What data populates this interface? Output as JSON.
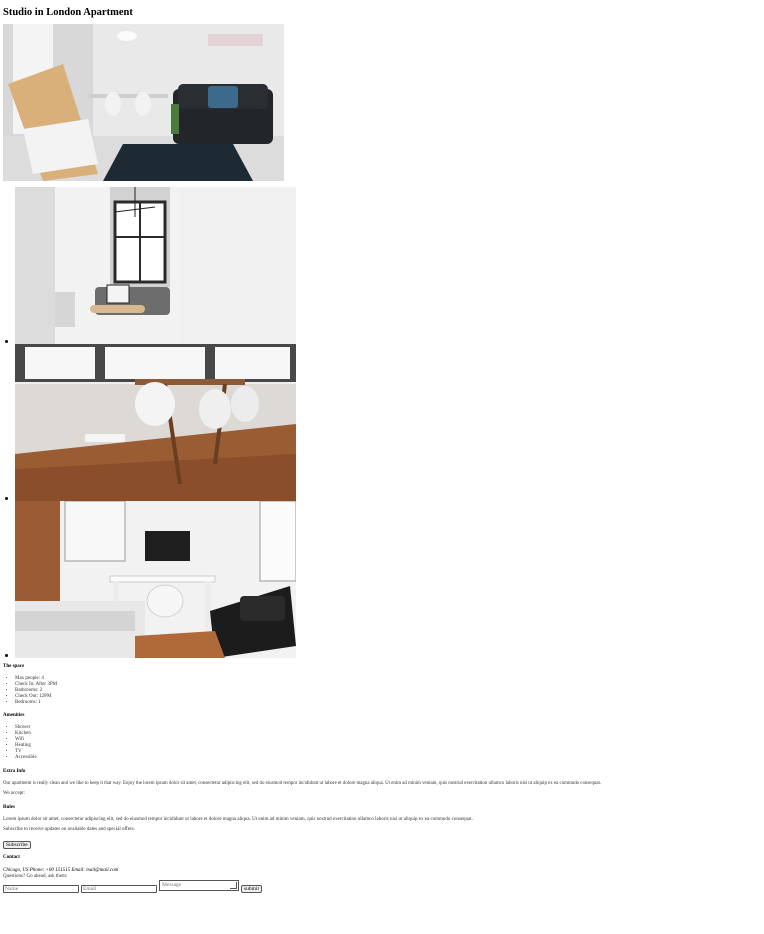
{
  "title": "Studio in London Apartment",
  "space": {
    "heading": "The space",
    "items": [
      "Max people: 4",
      "Check In: After 3PM",
      "Bathrooms: 2",
      "Check Out: 12PM",
      "Bedrooms: 1"
    ]
  },
  "amenities": {
    "heading": "Amenities",
    "items": [
      "Shower",
      "Kitchen",
      "Wifi",
      "Heating",
      "TV",
      "Accessible"
    ]
  },
  "extra": {
    "heading": "Extra Info",
    "text": "Our apartment is really clean and we like to keep it that way. Enjoy the lorem ipsum dolor sit amet, consectetur adipiscing elit, sed do eiusmod tempor incididunt ut labore et dolore magna aliqua. Ut enim ad minim veniam, quis nostrud exercitation ullamco laboris nisi ut aliquip ex ea commodo consequat.",
    "accept": "We accept:"
  },
  "rules": {
    "heading": "Rules",
    "text": "Lorem ipsum dolor sit amet, consectetur adipiscing elit, sed do eiusmod tempor incididunt ut labore et dolore magna aliqua. Ut enim ad minim veniam, quis nostrud exercitation ullamco laboris nisi ut aliquip ex ea commodo consequat.",
    "subscribe_text": "Subscribe to receive updates on available dates and special offers.",
    "subscribe_label": "Subscribe"
  },
  "contact": {
    "heading": "Contact",
    "info": "Chicago, US Phone: +00 151515 Email: mail@mail.com",
    "question": "Questions? Go ahead, ask them:",
    "name_placeholder": "Name",
    "email_placeholder": "Email",
    "message_placeholder": "Message",
    "submit_label": "submit"
  },
  "photos": [
    "living-room-photo",
    "lounge-photo",
    "dining-photo",
    "bedroom-photo"
  ]
}
